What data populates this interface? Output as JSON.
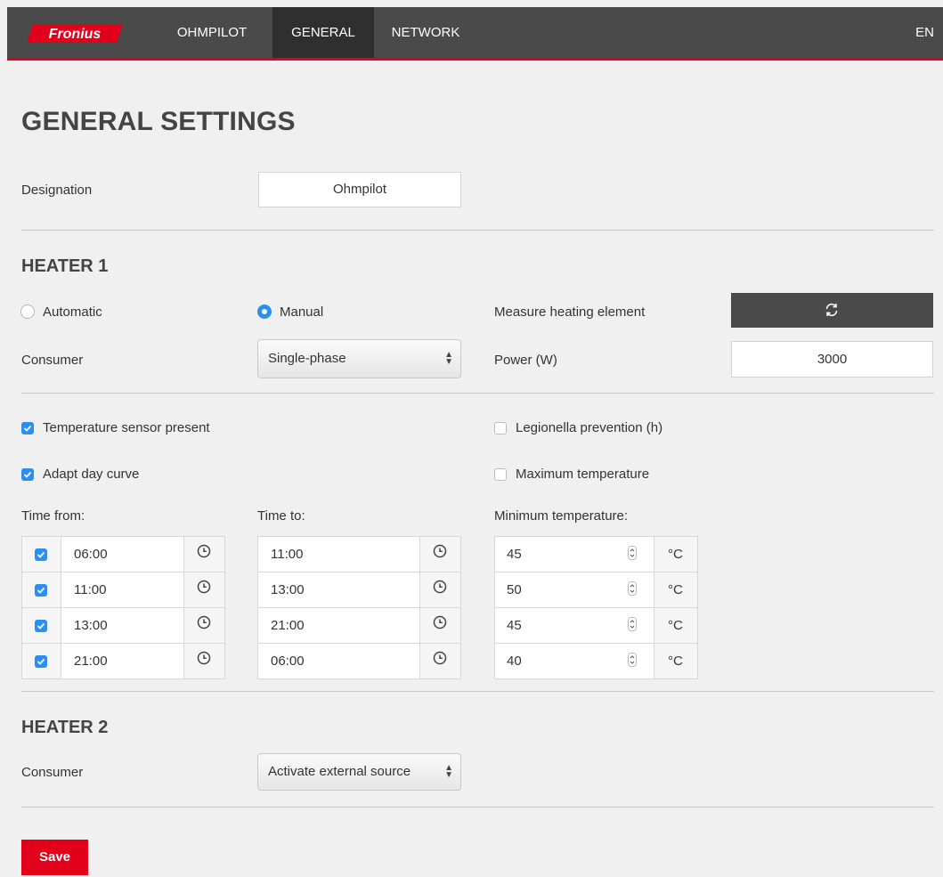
{
  "nav": {
    "logo_text": "Fronius",
    "items": [
      {
        "label": "OHMPILOT"
      },
      {
        "label": "GENERAL"
      },
      {
        "label": "NETWORK"
      }
    ],
    "lang": "EN"
  },
  "page_title": "GENERAL SETTINGS",
  "designation": {
    "label": "Designation",
    "value": "Ohmpilot"
  },
  "heater1": {
    "title": "HEATER 1",
    "mode_automatic": "Automatic",
    "mode_manual": "Manual",
    "selected_mode": "Manual",
    "measure_label": "Measure heating element",
    "consumer_label": "Consumer",
    "consumer_value": "Single-phase",
    "power_label": "Power (W)",
    "power_value": "3000",
    "temp_sensor_label": "Temperature sensor present",
    "temp_sensor_checked": true,
    "legionella_label": "Legionella prevention (h)",
    "legionella_checked": false,
    "adapt_label": "Adapt day curve",
    "adapt_checked": true,
    "maxtemp_label": "Maximum temperature",
    "maxtemp_checked": false,
    "time_from_label": "Time from:",
    "time_to_label": "Time to:",
    "min_temp_label": "Minimum temperature:",
    "unit": "°C",
    "schedule": [
      {
        "enabled": true,
        "from": "06:00",
        "to": "11:00",
        "temp": "45"
      },
      {
        "enabled": true,
        "from": "11:00",
        "to": "13:00",
        "temp": "50"
      },
      {
        "enabled": true,
        "from": "13:00",
        "to": "21:00",
        "temp": "45"
      },
      {
        "enabled": true,
        "from": "21:00",
        "to": "06:00",
        "temp": "40"
      }
    ]
  },
  "heater2": {
    "title": "HEATER 2",
    "consumer_label": "Consumer",
    "consumer_value": "Activate external source"
  },
  "save_label": "Save",
  "colors": {
    "accent_red": "#e2001a",
    "nav_bg": "#4a4a4a",
    "check_blue": "#2b8ff0"
  }
}
